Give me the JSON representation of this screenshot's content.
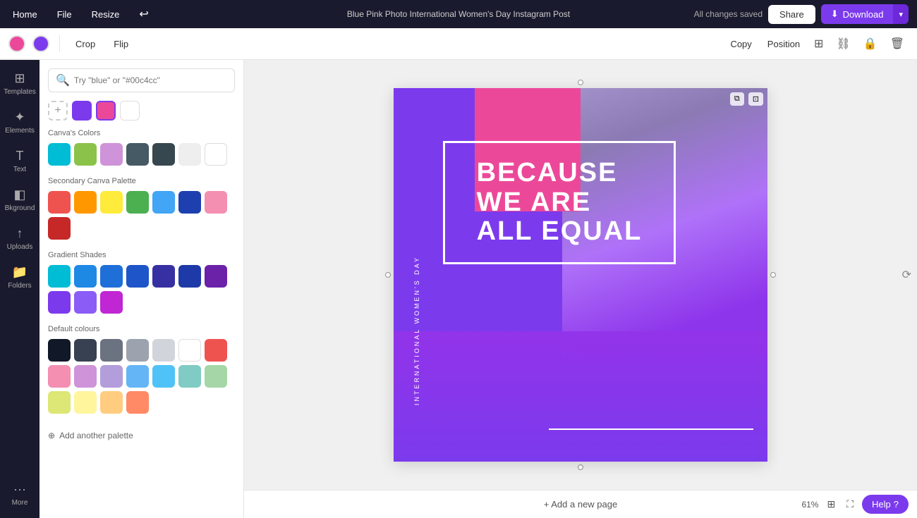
{
  "topnav": {
    "home_label": "Home",
    "file_label": "File",
    "resize_label": "Resize",
    "undo_icon": "↩",
    "saved_text": "All changes saved",
    "title": "Blue Pink Photo International Women's Day Instagram Post",
    "share_label": "Share",
    "download_label": "Download",
    "download_arrow": "▾"
  },
  "toolbar": {
    "color1": "#ec4899",
    "color2": "#7c3aed",
    "crop_label": "Crop",
    "flip_label": "Flip",
    "copy_label": "Copy",
    "position_label": "Position",
    "grid_icon": "⊞",
    "chain_icon": "🔗",
    "lock_icon": "🔒",
    "trash_icon": "🗑"
  },
  "sidebar": {
    "items": [
      {
        "label": "Templates",
        "icon": "⊞"
      },
      {
        "label": "Elements",
        "icon": "✦"
      },
      {
        "label": "Text",
        "icon": "T"
      },
      {
        "label": "Bkground",
        "icon": "◧"
      },
      {
        "label": "Uploads",
        "icon": "↑"
      },
      {
        "label": "Folders",
        "icon": "📁"
      },
      {
        "label": "More",
        "icon": "···"
      }
    ]
  },
  "color_panel": {
    "search_placeholder": "Try \"blue\" or \"#00c4cc\"",
    "search_icon": "🔍",
    "recent_colors": [
      "#7c3aed",
      "#ec4899",
      "#ffffff"
    ],
    "canva_colors_title": "Canva's Colors",
    "canva_colors": [
      "#00bcd4",
      "#8bc34a",
      "#ce93d8",
      "#455a64",
      "#37474f",
      "#f5f5f5",
      "#ffffff"
    ],
    "secondary_title": "Secondary Canva Palette",
    "secondary_colors": [
      "#ef5350",
      "#ff9800",
      "#ffeb3b",
      "#4caf50",
      "#42a5f5",
      "#1e40af",
      "#f06292",
      "#c62828"
    ],
    "gradient_title": "Gradient Shades",
    "gradient_colors": [
      "#00bcd4",
      "#1e88e5",
      "#1e6fd8",
      "#1e55c8",
      "#1e40b8",
      "#1e3aa8",
      "#6b21a8",
      "#7c3aed",
      "#8b5cf6",
      "#c026d3"
    ],
    "default_title": "Default colours",
    "default_colors": [
      "#111827",
      "#374151",
      "#6b7280",
      "#9ca3af",
      "#d1d5db",
      "#ffffff",
      "#ef5350",
      "#f48fb1",
      "#ce93d8",
      "#b39ddb",
      "#64b5f6",
      "#4fc3f7",
      "#80cbc4",
      "#a5d6a7",
      "#dce775",
      "#fff59d",
      "#ffcc80",
      "#ff8a65"
    ],
    "add_palette_label": "Add another palette"
  },
  "canvas": {
    "headline_line1": "BECAUSE",
    "headline_line2": "WE ARE",
    "headline_line3": "ALL EQUAL",
    "vertical_text": "INTERNATIONAL WOMEN'S DAY"
  },
  "bottom_bar": {
    "add_page_label": "+ Add a new page",
    "zoom_level": "61%",
    "zoom_in": "+",
    "zoom_out": "−",
    "help_label": "Help",
    "help_icon": "?"
  }
}
